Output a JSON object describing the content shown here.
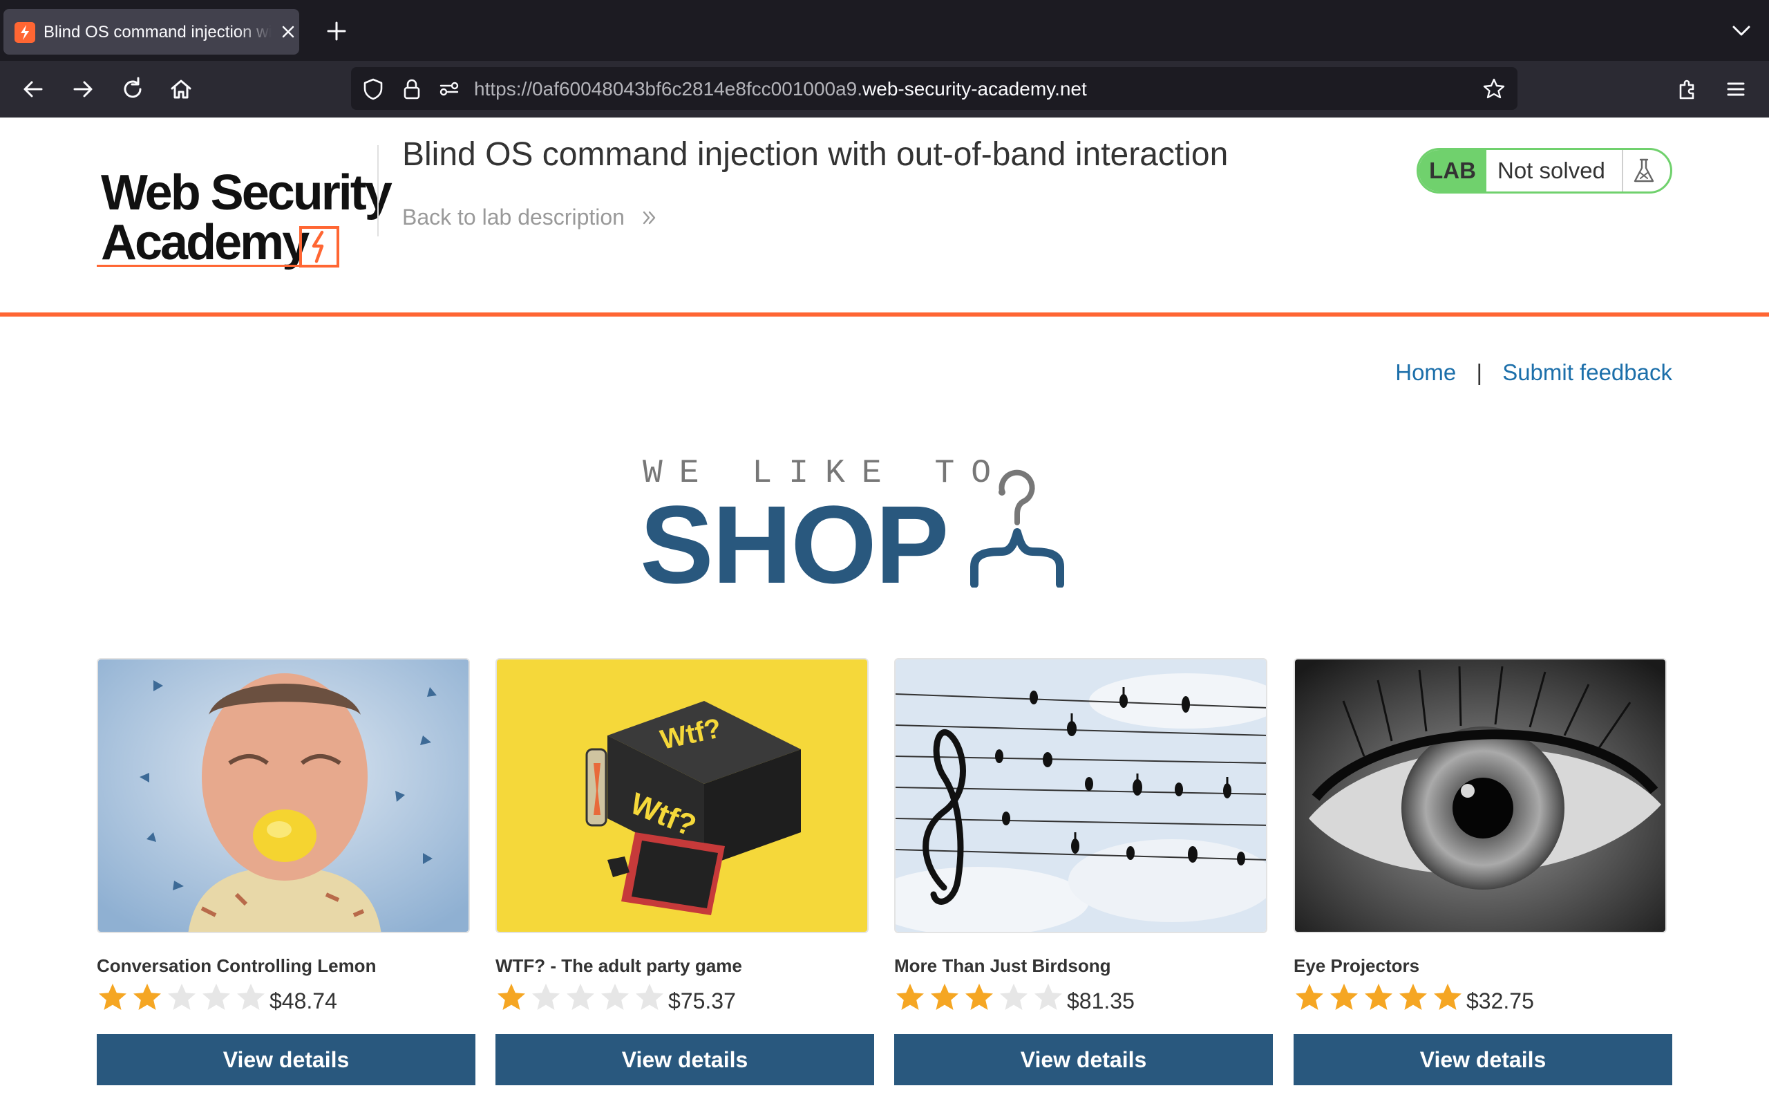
{
  "browser": {
    "tab_title": "Blind OS command injection with out-of-band interaction",
    "url_prefix": "https://0af60048043bf6c2814e8fcc001000a9.",
    "url_domain": "web-security-academy.net"
  },
  "lab_header": {
    "logo_line1": "Web Security",
    "logo_line2": "Academy",
    "title": "Blind OS command injection with out-of-band interaction",
    "back_link": "Back to lab description",
    "status_pill": "LAB",
    "status_text": "Not solved"
  },
  "nav": {
    "home": "Home",
    "separator": "|",
    "feedback": "Submit feedback"
  },
  "banner": {
    "small": "WE LIKE TO",
    "big": "SHOP"
  },
  "products": [
    {
      "name": "Conversation Controlling Lemon",
      "rating": 2,
      "price": "$48.74",
      "button": "View details"
    },
    {
      "name": "WTF? - The adult party game",
      "rating": 1,
      "price": "$75.37",
      "button": "View details"
    },
    {
      "name": "More Than Just Birdsong",
      "rating": 3,
      "price": "$81.35",
      "button": "View details"
    },
    {
      "name": "Eye Projectors",
      "rating": 5,
      "price": "$32.75",
      "button": "View details"
    }
  ],
  "colors": {
    "accent_orange": "#ff6633",
    "brand_blue": "#29587e",
    "link_blue": "#1c6faa",
    "lab_green": "#70d16d",
    "star_filled": "#f5a623",
    "star_empty": "#e6e6e6"
  },
  "icons": [
    "back-arrow-icon",
    "forward-arrow-icon",
    "reload-icon",
    "home-icon",
    "shield-icon",
    "lock-icon",
    "permissions-icon",
    "bookmark-star-icon",
    "extensions-icon",
    "menu-icon",
    "chevron-double-right-icon",
    "flask-icon",
    "hanger-icon",
    "star-icon"
  ]
}
